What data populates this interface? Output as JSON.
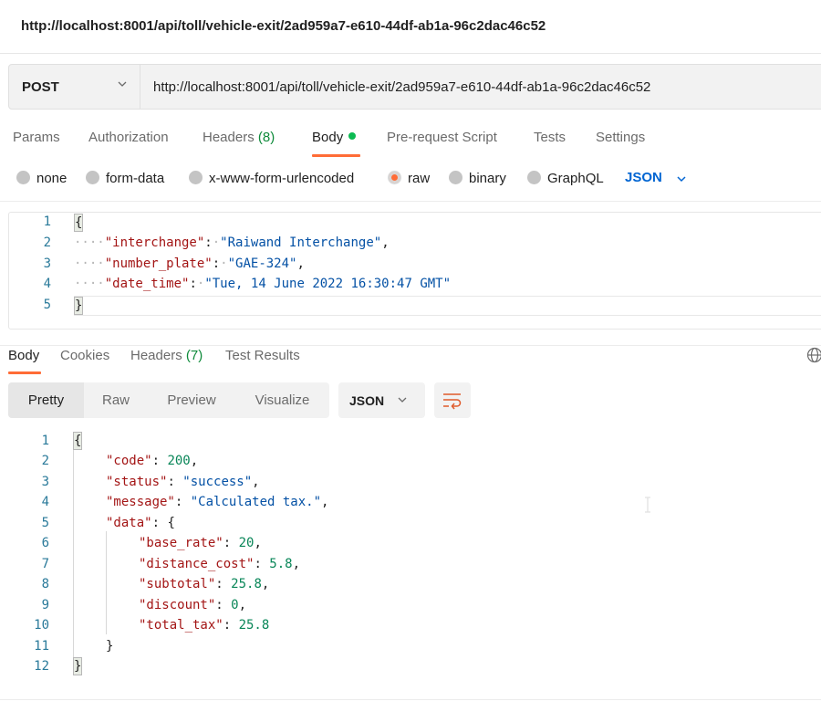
{
  "title": "http://localhost:8001/api/toll/vehicle-exit/2ad959a7-e610-44df-ab1a-96c2dac46c52",
  "request": {
    "method": "POST",
    "url": "http://localhost:8001/api/toll/vehicle-exit/2ad959a7-e610-44df-ab1a-96c2dac46c52",
    "tabs": [
      {
        "label": "Params"
      },
      {
        "label": "Authorization"
      },
      {
        "label": "Headers",
        "count": "(8)"
      },
      {
        "label": "Body",
        "active": true
      },
      {
        "label": "Pre-request Script"
      },
      {
        "label": "Tests"
      },
      {
        "label": "Settings"
      }
    ],
    "body_types": [
      {
        "label": "none",
        "selected": false
      },
      {
        "label": "form-data",
        "selected": false
      },
      {
        "label": "x-www-form-urlencoded",
        "selected": false
      },
      {
        "label": "raw",
        "selected": true
      },
      {
        "label": "binary",
        "selected": false
      },
      {
        "label": "GraphQL",
        "selected": false
      }
    ],
    "language": "JSON",
    "body_lines": [
      {
        "n": "1",
        "text": "{"
      },
      {
        "n": "2",
        "key": "\"interchange\"",
        "value": "\"Raiwand Interchange\"",
        "trail": ","
      },
      {
        "n": "3",
        "key": "\"number_plate\"",
        "value": "\"GAE-324\"",
        "trail": ","
      },
      {
        "n": "4",
        "key": "\"date_time\"",
        "value": "\"Tue, 14 June 2022 16:30:47 GMT\"",
        "trail": ""
      },
      {
        "n": "5",
        "text": "}"
      }
    ]
  },
  "response": {
    "tabs": [
      {
        "label": "Body",
        "active": true
      },
      {
        "label": "Cookies"
      },
      {
        "label": "Headers",
        "count": "(7)"
      },
      {
        "label": "Test Results"
      }
    ],
    "views": [
      "Pretty",
      "Raw",
      "Preview",
      "Visualize"
    ],
    "active_view": "Pretty",
    "format": "JSON",
    "lines": [
      {
        "n": "1",
        "text": "{"
      },
      {
        "n": "2",
        "key": "\"code\"",
        "value": "200",
        "type": "n",
        "trail": ","
      },
      {
        "n": "3",
        "key": "\"status\"",
        "value": "\"success\"",
        "type": "s",
        "trail": ","
      },
      {
        "n": "4",
        "key": "\"message\"",
        "value": "\"Calculated tax.\"",
        "type": "s",
        "trail": ","
      },
      {
        "n": "5",
        "key": "\"data\"",
        "value": "{",
        "type": "p",
        "trail": ""
      },
      {
        "n": "6",
        "key": "\"base_rate\"",
        "value": "20",
        "type": "n",
        "trail": ","
      },
      {
        "n": "7",
        "key": "\"distance_cost\"",
        "value": "5.8",
        "type": "n",
        "trail": ","
      },
      {
        "n": "8",
        "key": "\"subtotal\"",
        "value": "25.8",
        "type": "n",
        "trail": ","
      },
      {
        "n": "9",
        "key": "\"discount\"",
        "value": "0",
        "type": "n",
        "trail": ","
      },
      {
        "n": "10",
        "key": "\"total_tax\"",
        "value": "25.8",
        "type": "n",
        "trail": ""
      },
      {
        "n": "11",
        "text": "}"
      },
      {
        "n": "12",
        "text": "}"
      }
    ]
  },
  "colors": {
    "accent": "#ff6c37",
    "body_dot": "#0cbb52",
    "count_green": "#0e8a3a",
    "json_key": "#a31515",
    "json_string": "#0451a5",
    "json_number": "#098658",
    "link_blue": "#0265d2"
  },
  "icons": {
    "method_dropdown": "chevron-down-icon",
    "language_dropdown": "chevron-down-icon",
    "globe": "globe-icon",
    "wrap": "wrap-lines-icon"
  }
}
